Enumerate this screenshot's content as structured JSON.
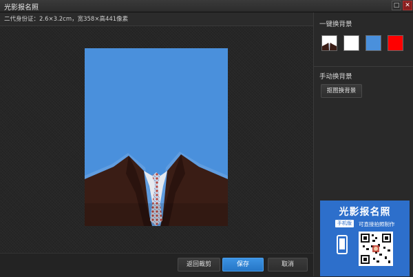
{
  "window": {
    "title": "光影报名照",
    "maximize_icon": "maximize-icon",
    "close_icon": "close-icon",
    "close_glyph": "✕",
    "maximize_glyph": "□"
  },
  "main": {
    "info_text": "二代身份证：2.6×3.2cm，宽358×高441像素",
    "photo_background_color": "#4a90dc"
  },
  "bottom_buttons": {
    "back_label": "返回裁剪",
    "save_label": "保存",
    "cancel_label": "取消"
  },
  "side": {
    "one_click_label": "一键换背景",
    "swatches": [
      {
        "name": "suit-preview",
        "color": "#ffffff"
      },
      {
        "name": "white",
        "color": "#ffffff"
      },
      {
        "name": "blue",
        "color": "#4a90dc"
      },
      {
        "name": "red",
        "color": "#ff0000"
      }
    ],
    "manual_label": "手动换背景",
    "cutout_label": "抠图换背景"
  },
  "ad": {
    "title": "光影报名照",
    "tag": "手机版",
    "subtitle": "可直接拍照制作"
  }
}
